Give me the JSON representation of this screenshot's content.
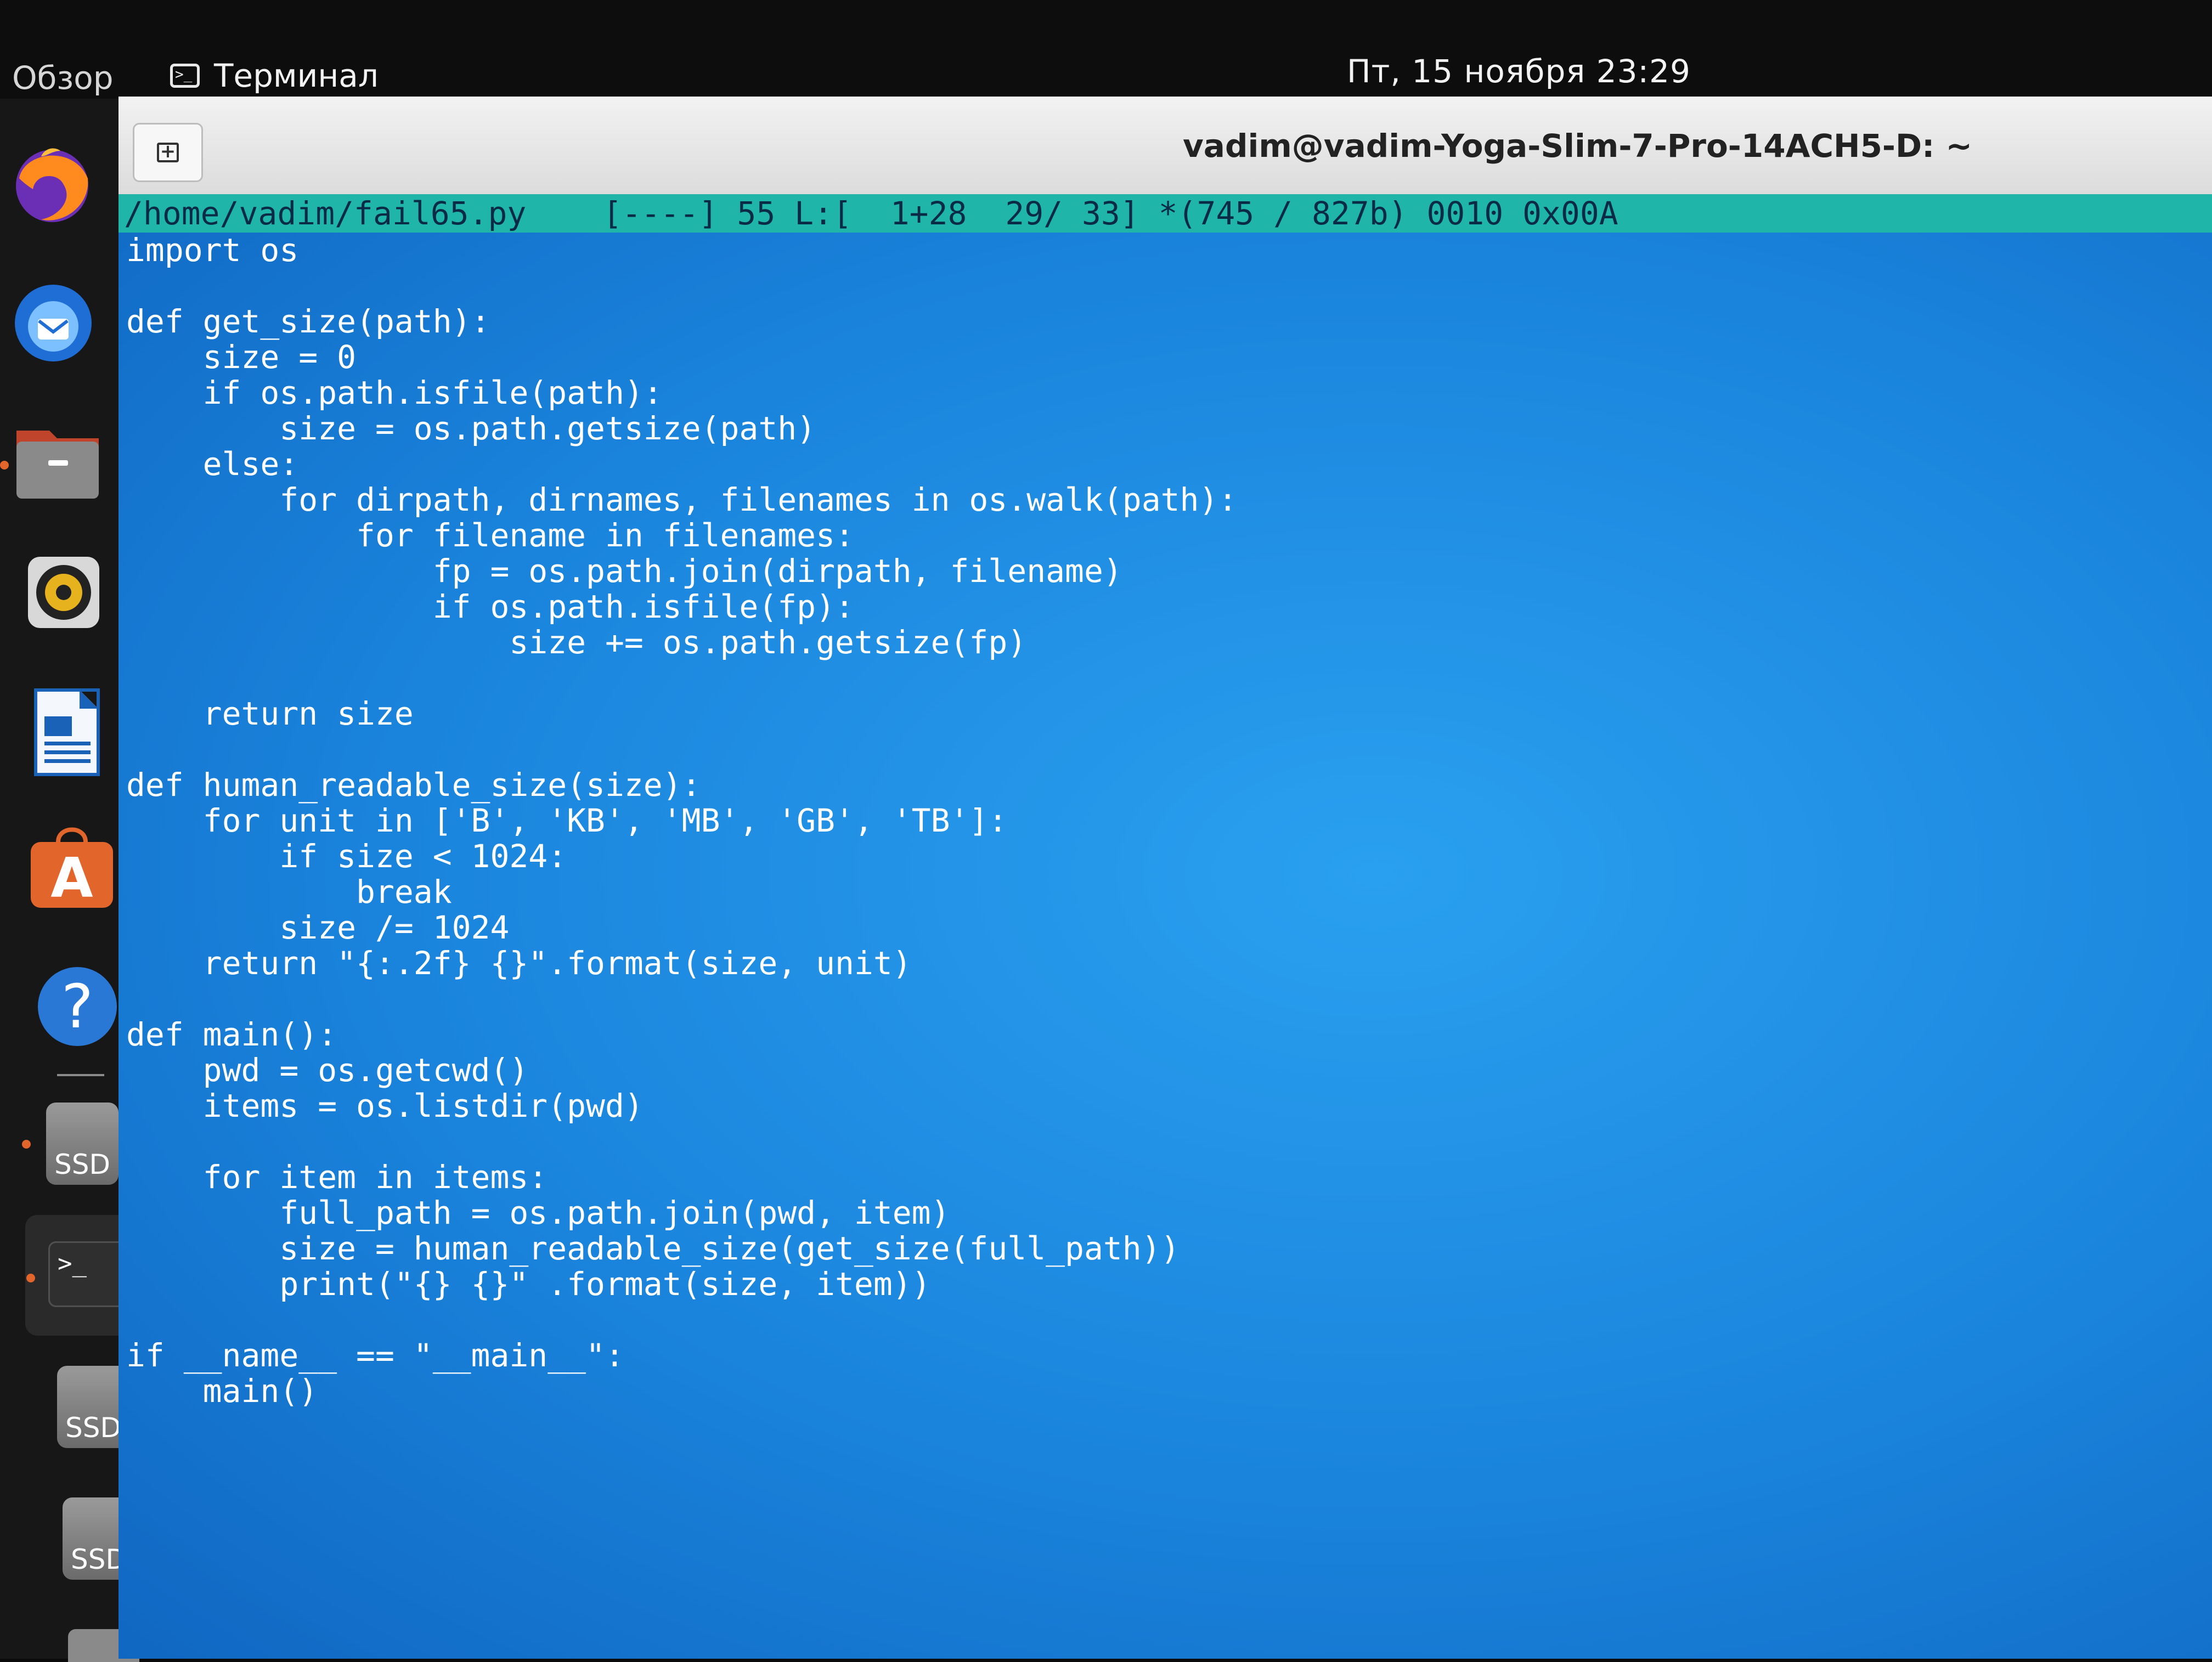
{
  "topbar": {
    "overview_label": "Обзор",
    "active_app_label": "Терминал",
    "active_app_icon": "terminal-icon",
    "clock": "Пт, 15 ноября  23:29"
  },
  "dock": {
    "items": [
      {
        "name": "firefox",
        "icon": "firefox-icon"
      },
      {
        "name": "thunderbird",
        "icon": "thunderbird-icon"
      },
      {
        "name": "files",
        "icon": "folder-icon"
      },
      {
        "name": "rhythmbox",
        "icon": "speaker-icon"
      },
      {
        "name": "libreoffice-writer",
        "icon": "document-icon"
      },
      {
        "name": "app-center",
        "icon": "app-store-icon"
      },
      {
        "name": "help",
        "icon": "help-icon"
      },
      {
        "name": "ssd-1",
        "label": "SSD"
      },
      {
        "name": "terminal",
        "icon": "terminal-icon",
        "prompt": ">_"
      },
      {
        "name": "ssd-2",
        "label": "SSD"
      },
      {
        "name": "ssd-3",
        "label": "SSD"
      }
    ]
  },
  "window": {
    "title": "vadim@vadim-Yoga-Slim-7-Pro-14ACH5-D: ~",
    "new_tab_icon": "new-tab-icon"
  },
  "editor": {
    "status_line": "/home/vadim/fail65.py    [----] 55 L:[  1+28  29/ 33] *(745 / 827b) 0010 0x00A",
    "lines": [
      "import os",
      "",
      "def get_size(path):",
      "    size = 0",
      "    if os.path.isfile(path):",
      "        size = os.path.getsize(path)",
      "    else:",
      "        for dirpath, dirnames, filenames in os.walk(path):",
      "            for filename in filenames:",
      "                fp = os.path.join(dirpath, filename)",
      "                if os.path.isfile(fp):",
      "                    size += os.path.getsize(fp)",
      "",
      "    return size",
      "",
      "def human_readable_size(size):",
      "    for unit in ['B', 'KB', 'MB', 'GB', 'TB']:",
      "        if size < 1024:",
      "            break",
      "        size /= 1024",
      "    return \"{:.2f} {}\".format(size, unit)",
      "",
      "def main():",
      "    pwd = os.getcwd()",
      "    items = os.listdir(pwd)",
      "",
      "    for item in items:",
      "        full_path = os.path.join(pwd, item)",
      "        size = human_readable_size(get_size(full_path))",
      "        print(\"{} {}\" .format(size, item))",
      "",
      "if __name__ == \"__main__\":",
      "    main()"
    ]
  },
  "colors": {
    "editor_bg": "#1a7fd9",
    "status_bg": "#1fb5a8",
    "dock_bg": "#181717",
    "running_dot": "#e2652c"
  }
}
